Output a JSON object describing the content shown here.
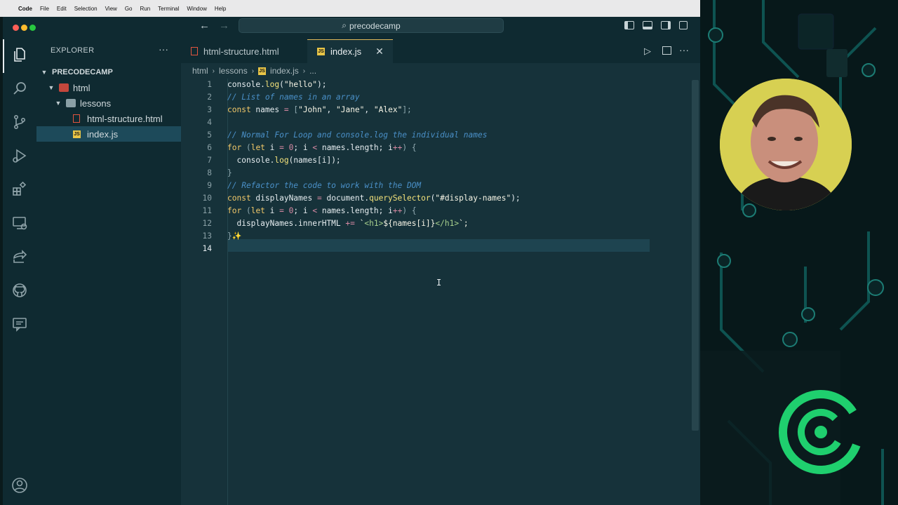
{
  "menubar": {
    "app_name": "Code",
    "items": [
      "File",
      "Edit",
      "Selection",
      "View",
      "Go",
      "Run",
      "Terminal",
      "Window",
      "Help"
    ]
  },
  "titlebar": {
    "search_text": "precodecamp"
  },
  "sidebar": {
    "title": "EXPLORER",
    "more": "···",
    "project": "PRECODECAMP",
    "folder_html": "html",
    "folder_lessons": "lessons",
    "file_html": "html-structure.html",
    "file_js": "index.js",
    "icon_js": "JS"
  },
  "tabs": {
    "tab1_label": "html-structure.html",
    "tab2_label": "index.js",
    "close": "✕"
  },
  "breadcrumb": {
    "part1": "html",
    "part2": "lessons",
    "part3": "index.js",
    "part4": "..."
  },
  "editor": {
    "line_numbers": [
      "1",
      "2",
      "3",
      "4",
      "5",
      "6",
      "7",
      "8",
      "9",
      "10",
      "11",
      "12",
      "13",
      "14"
    ],
    "line1": {
      "a": "console.",
      "b": "log",
      "c": "(",
      "d": "\"hello\"",
      "e": ");"
    },
    "line2": "// List of names in an array",
    "line3": {
      "a": "const",
      "b": " names ",
      "c": "=",
      "d": " [",
      "e": "\"John\"",
      "f": ", ",
      "g": "\"Jane\"",
      "h": ", ",
      "i": "\"Alex\"",
      "j": "];"
    },
    "line5": "// Normal For Loop and console.log the individual names",
    "line6": {
      "a": "for",
      "b": " (",
      "c": "let",
      "d": " i ",
      "e": "=",
      "f": " ",
      "g": "0",
      "h": "; i ",
      "i": "<",
      "j": " names.length; i",
      "k": "++",
      "l": ") {"
    },
    "line7": {
      "a": "  console.",
      "b": "log",
      "c": "(names[i]);"
    },
    "line8": "}",
    "line9": "// Refactor the code to work with the DOM",
    "line10": {
      "a": "const",
      "b": " displayNames ",
      "c": "=",
      "d": " document.",
      "e": "querySelector",
      "f": "(",
      "g": "\"#display-names\"",
      "h": ");"
    },
    "line11": {
      "a": "for",
      "b": " (",
      "c": "let",
      "d": " i ",
      "e": "=",
      "f": " ",
      "g": "0",
      "h": "; i ",
      "i": "<",
      "j": " names.length; i",
      "k": "++",
      "l": ") {"
    },
    "line12": {
      "a": "  displayNames.innerHTML ",
      "b": "+=",
      "c": " `",
      "d": "<h1>",
      "e": "${names[i]}",
      "f": "</h1>",
      "g": "`;"
    },
    "line13": "}✨"
  },
  "colors": {
    "editor_bg": "#16323a",
    "sidebar_bg": "#0f2a31",
    "accent": "#e0b85a",
    "selection": "#1d4a5a",
    "logo_green": "#1fcf6e"
  },
  "icons": {
    "activity": [
      "files-icon",
      "search-icon",
      "source-control-icon",
      "run-debug-icon",
      "extensions-icon",
      "remote-explorer-icon",
      "live-share-icon",
      "github-icon",
      "comments-icon",
      "account-icon"
    ]
  }
}
